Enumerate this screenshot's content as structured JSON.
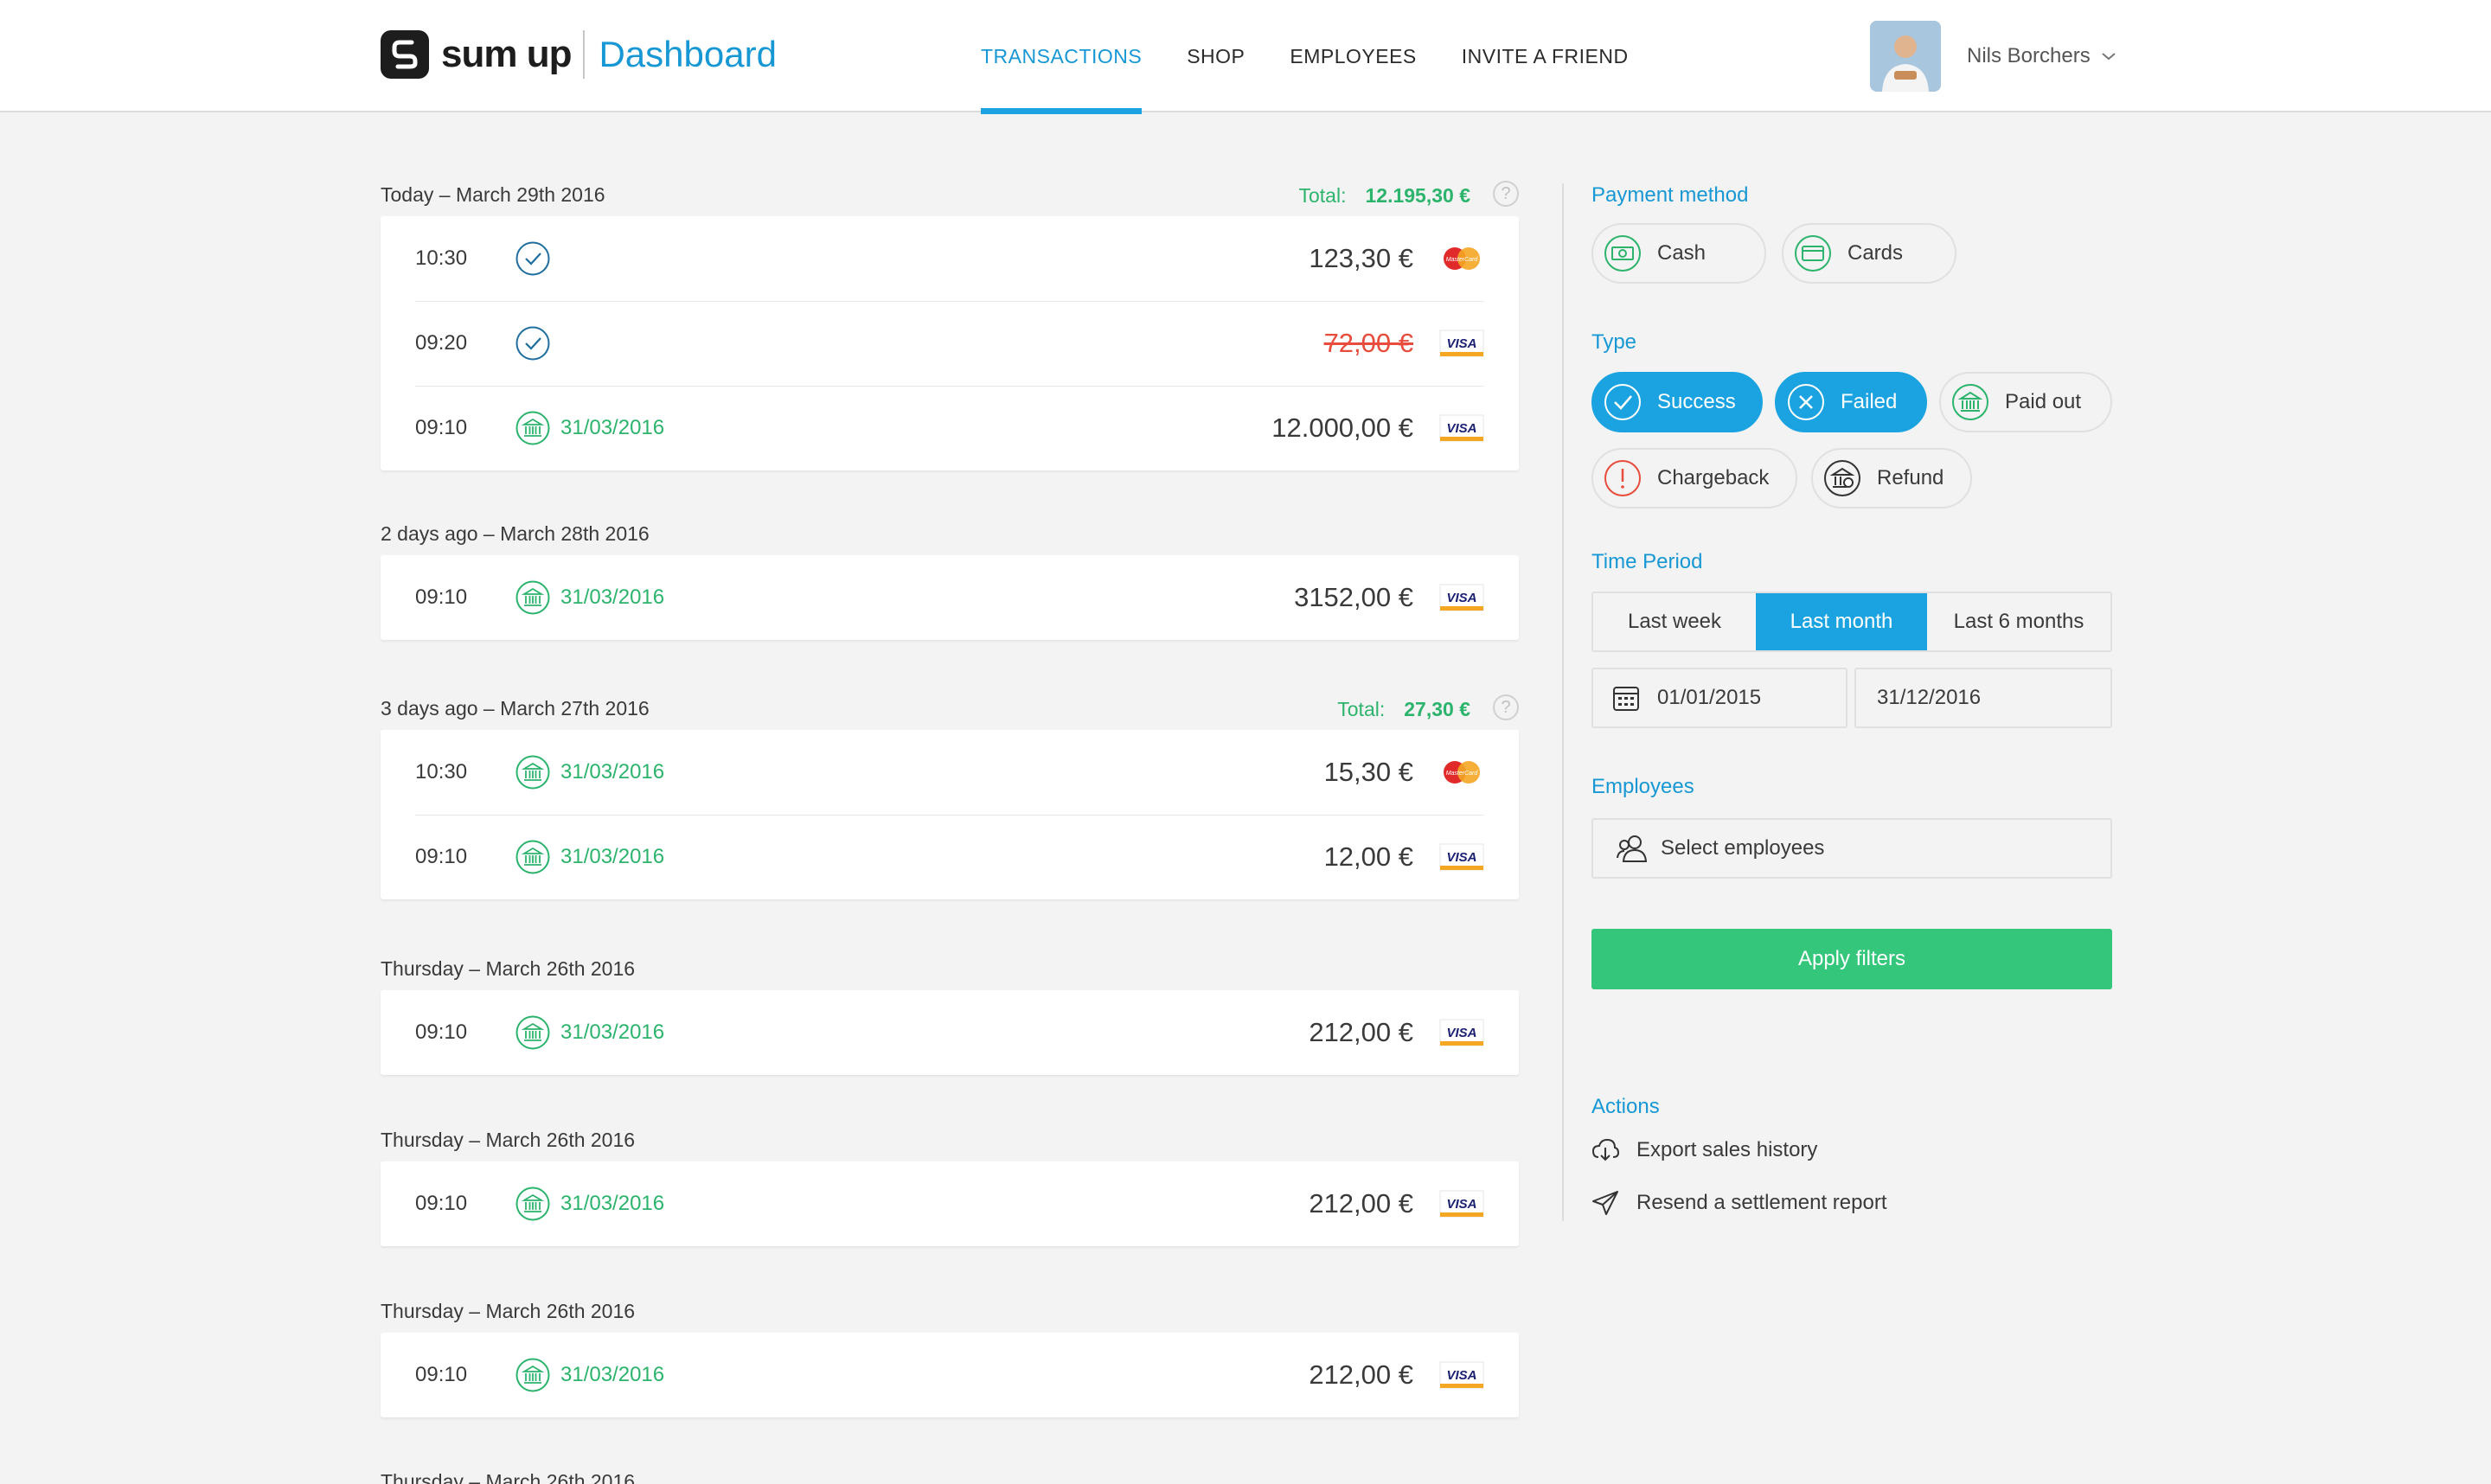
{
  "brand": {
    "name": "sum up",
    "product": "Dashboard"
  },
  "nav": [
    {
      "label": "TRANSACTIONS",
      "active": true
    },
    {
      "label": "SHOP",
      "active": false
    },
    {
      "label": "EMPLOYEES",
      "active": false
    },
    {
      "label": "INVITE A FRIEND",
      "active": false
    }
  ],
  "user": {
    "name": "Nils Borchers"
  },
  "days": [
    {
      "label": "Today – March 29th 2016",
      "total_label": "Total:",
      "total": "12.195,30 €",
      "rows": [
        {
          "time": "10:30",
          "status": "success",
          "payout_date": "",
          "amount": "123,30 €",
          "card": "mastercard"
        },
        {
          "time": "09:20",
          "status": "failed",
          "payout_date": "",
          "amount": "72,00 €",
          "card": "visa"
        },
        {
          "time": "09:10",
          "status": "paid-out",
          "payout_date": "31/03/2016",
          "amount": "12.000,00 €",
          "card": "visa"
        }
      ]
    },
    {
      "label": "2 days ago – March 28th 2016",
      "total_label": "",
      "total": "",
      "rows": [
        {
          "time": "09:10",
          "status": "paid-out",
          "payout_date": "31/03/2016",
          "amount": "3152,00 €",
          "card": "visa"
        }
      ]
    },
    {
      "label": "3 days ago – March 27th 2016",
      "total_label": "Total:",
      "total": "27,30 €",
      "rows": [
        {
          "time": "10:30",
          "status": "paid-out",
          "payout_date": "31/03/2016",
          "amount": "15,30 €",
          "card": "mastercard"
        },
        {
          "time": "09:10",
          "status": "paid-out",
          "payout_date": "31/03/2016",
          "amount": "12,00 €",
          "card": "visa"
        }
      ]
    },
    {
      "label": "Thursday – March 26th 2016",
      "total_label": "",
      "total": "",
      "rows": [
        {
          "time": "09:10",
          "status": "paid-out",
          "payout_date": "31/03/2016",
          "amount": "212,00 €",
          "card": "visa"
        }
      ]
    },
    {
      "label": "Thursday – March 26th 2016",
      "total_label": "",
      "total": "",
      "rows": [
        {
          "time": "09:10",
          "status": "paid-out",
          "payout_date": "31/03/2016",
          "amount": "212,00 €",
          "card": "visa"
        }
      ]
    },
    {
      "label": "Thursday – March 26th 2016",
      "total_label": "",
      "total": "",
      "rows": [
        {
          "time": "09:10",
          "status": "paid-out",
          "payout_date": "31/03/2016",
          "amount": "212,00 €",
          "card": "visa"
        }
      ]
    },
    {
      "label": "Thursday – March 26th 2016",
      "total_label": "",
      "total": "",
      "rows": []
    }
  ],
  "card_brands": {
    "visa": "VISA",
    "mastercard": "MasterCard"
  },
  "filters": {
    "payment_method": {
      "title": "Payment method",
      "options": [
        {
          "label": "Cash",
          "selected": false
        },
        {
          "label": "Cards",
          "selected": false
        }
      ]
    },
    "type": {
      "title": "Type",
      "options": [
        {
          "label": "Success",
          "selected": true
        },
        {
          "label": "Failed",
          "selected": true
        },
        {
          "label": "Paid out",
          "selected": false
        },
        {
          "label": "Chargeback",
          "selected": false
        },
        {
          "label": "Refund",
          "selected": false
        }
      ]
    },
    "time_period": {
      "title": "Time Period",
      "options": [
        {
          "label": "Last week",
          "selected": false
        },
        {
          "label": "Last month",
          "selected": true
        },
        {
          "label": "Last 6 months",
          "selected": false
        }
      ],
      "from": "01/01/2015",
      "to": "31/12/2016"
    },
    "employees": {
      "title": "Employees",
      "placeholder": "Select employees"
    },
    "apply_label": "Apply filters"
  },
  "actions": {
    "title": "Actions",
    "items": [
      "Export sales history",
      "Resend a settlement report"
    ]
  },
  "colors": {
    "accent": "#1aa3e0",
    "success": "#2cb36c",
    "failed": "#e74c3c",
    "apply": "#34c77b"
  }
}
